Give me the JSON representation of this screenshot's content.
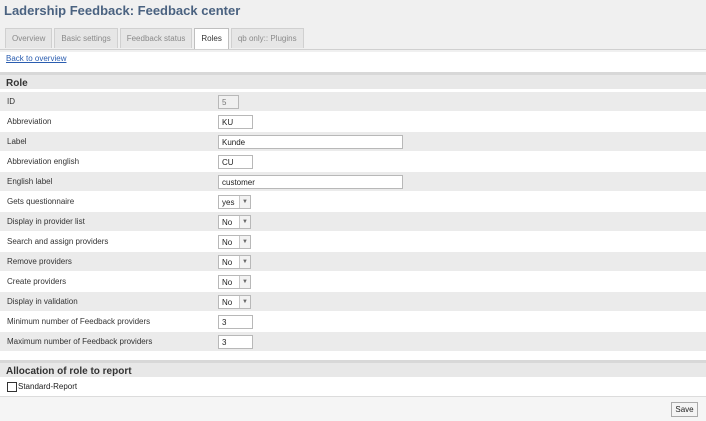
{
  "app": {
    "title": "Ladership Feedback: Feedback center"
  },
  "tabs": [
    "Overview",
    "Basic settings",
    "Feedback status",
    "Roles",
    "qb only:: Plugins"
  ],
  "active_tab": "Roles",
  "back_link": "Back to overview",
  "role_section": {
    "title": "Role"
  },
  "fields": {
    "id": {
      "label": "ID",
      "value": "5"
    },
    "abbreviation": {
      "label": "Abbreviation",
      "value": "KU"
    },
    "label": {
      "label": "Label",
      "value": "Kunde"
    },
    "abbreviation_english": {
      "label": "Abbreviation english",
      "value": "CU"
    },
    "english_label": {
      "label": "English label",
      "value": "customer"
    },
    "gets_questionnaire": {
      "label": "Gets questionnaire",
      "value": "yes"
    },
    "display_in_provider_list": {
      "label": "Display in provider list",
      "value": "No"
    },
    "search_and_assign_providers": {
      "label": "Search and assign providers",
      "value": "No"
    },
    "remove_providers": {
      "label": "Remove providers",
      "value": "No"
    },
    "create_providers": {
      "label": "Create providers",
      "value": "No"
    },
    "display_in_validation": {
      "label": "Display in validation",
      "value": "No"
    },
    "min_feedback_providers": {
      "label": "Minimum number of Feedback providers",
      "value": "3"
    },
    "max_feedback_providers": {
      "label": "Maximum number of Feedback providers",
      "value": "3"
    }
  },
  "allocation_section": {
    "title": "Allocation of role to report"
  },
  "allocation": {
    "report_label": "Standard-Report",
    "checked": false
  },
  "footer": {
    "save_label": "Save"
  }
}
